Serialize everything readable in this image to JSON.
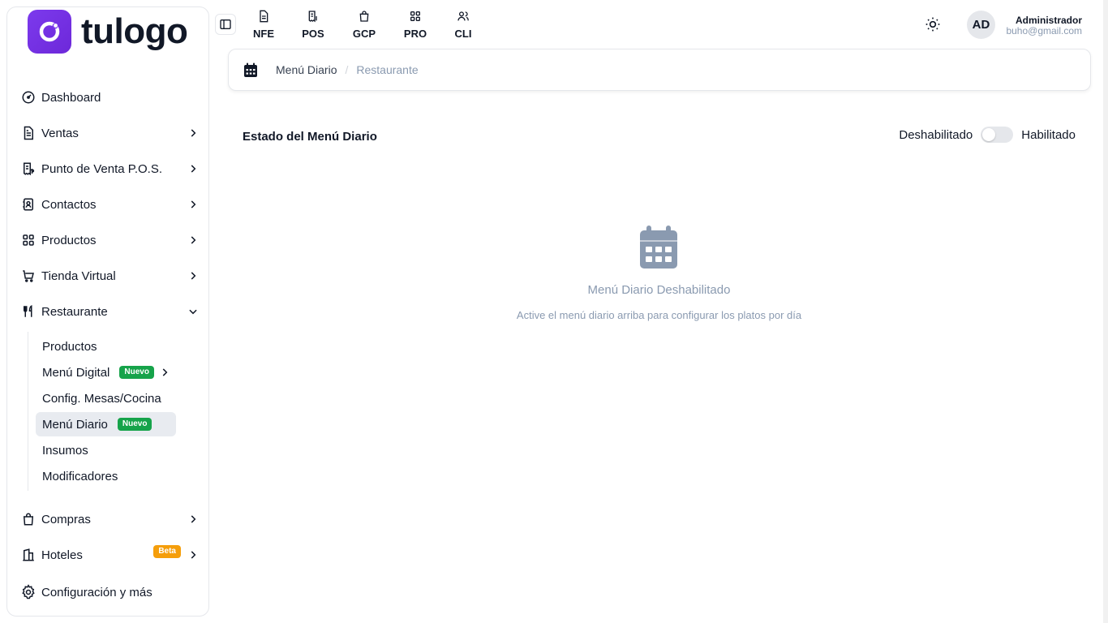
{
  "brand": {
    "name": "tulogo",
    "accent": "#7c3aed"
  },
  "sidebar": {
    "items": [
      {
        "label": "Dashboard",
        "icon": "gauge-icon"
      },
      {
        "label": "Ventas",
        "icon": "document-icon"
      },
      {
        "label": "Punto de Venta P.O.S.",
        "icon": "receipt-icon"
      },
      {
        "label": "Contactos",
        "icon": "contacts-icon"
      },
      {
        "label": "Productos",
        "icon": "grid-icon"
      },
      {
        "label": "Tienda Virtual",
        "icon": "cart-icon"
      },
      {
        "label": "Restaurante",
        "icon": "utensils-icon"
      },
      {
        "label": "Compras",
        "icon": "shopping-bag-icon"
      },
      {
        "label": "Hoteles",
        "icon": "building-icon",
        "badge": "Beta"
      },
      {
        "label": "Configuración y más",
        "icon": "gear-icon"
      }
    ],
    "restaurante_sub": [
      {
        "label": "Productos"
      },
      {
        "label": "Menú Digital",
        "badge": "Nuevo"
      },
      {
        "label": "Config. Mesas/Cocina"
      },
      {
        "label": "Menú Diario",
        "badge": "Nuevo",
        "active": true
      },
      {
        "label": "Insumos"
      },
      {
        "label": "Modificadores"
      }
    ]
  },
  "topbar": {
    "tabs": [
      {
        "label": "NFE",
        "icon": "document-icon"
      },
      {
        "label": "POS",
        "icon": "receipt-icon"
      },
      {
        "label": "GCP",
        "icon": "shopping-bag-icon"
      },
      {
        "label": "PRO",
        "icon": "grid-icon"
      },
      {
        "label": "CLI",
        "icon": "users-icon"
      }
    ],
    "user": {
      "initials": "AD",
      "name": "Administrador",
      "email": "buho@gmail.com"
    }
  },
  "breadcrumb": {
    "items": [
      "Menú Diario",
      "Restaurante"
    ],
    "separator": "/"
  },
  "main": {
    "title": "Estado del Menú Diario",
    "toggle": {
      "off_label": "Deshabilitado",
      "on_label": "Habilitado",
      "enabled": false
    },
    "empty_state": {
      "title": "Menú Diario Deshabilitado",
      "subtitle": "Active el menú diario arriba para configurar los platos por día"
    }
  }
}
